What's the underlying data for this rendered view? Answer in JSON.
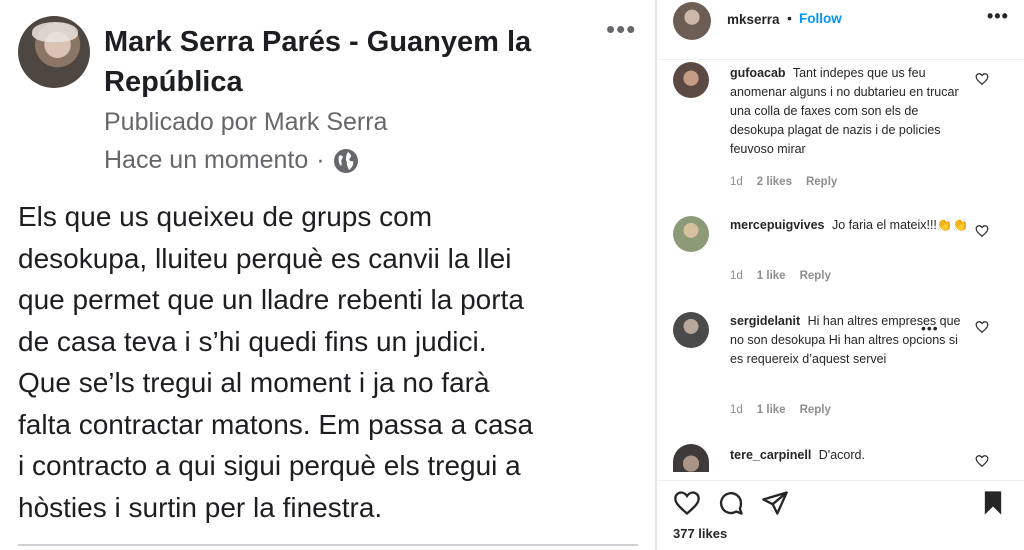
{
  "facebook_post": {
    "title": "Mark Serra Parés - Guanyem la República",
    "more_menu": "•••",
    "published_by": "Publicado por Mark Serra",
    "time": "Hace un momento",
    "time_separator": "·",
    "body_lines": [
      "Els que us queixeu de grups com",
      "desokupa, lluiteu perquè es canvii la llei",
      "que permet que un lladre rebenti la porta",
      "de casa teva i s’hi quedi fins un judici.",
      "Que se’ls tregui al moment i ja no farà",
      "falta contractar matons. Em passa a casa",
      "i contracto a qui sigui perquè els tregui a",
      "hòsties i surtin per la finestra."
    ]
  },
  "instagram": {
    "header": {
      "username": "mkserra",
      "dot": "•",
      "follow_label": "Follow",
      "more_menu": "•••"
    },
    "comments": [
      {
        "username": "gufoacab",
        "text": "Tant indepes que us feu anomenar alguns i no dubtarieu en trucar una colla de faxes com son els de desokupa plagat de nazis i de policies feuvoso mirar",
        "time": "1d",
        "likes": "2 likes",
        "reply": "Reply"
      },
      {
        "username": "mercepuigvives",
        "text": "Jo faria el mateix!!!👏👏",
        "time": "1d",
        "likes": "1 like",
        "reply": "Reply"
      },
      {
        "username": "sergidelanit",
        "text": "Hi han altres empreses que no son desokupa Hi han altres opcions si es requereix d’aquest servei",
        "time": "1d",
        "likes": "1 like",
        "reply": "Reply",
        "more_menu": "•••"
      },
      {
        "username": "tere_carpinell",
        "text": "D'acord.",
        "time": "",
        "likes": "",
        "reply": ""
      }
    ],
    "likes_count": "377 likes",
    "icons": [
      "heart-icon",
      "comment-icon",
      "share-icon",
      "bookmark-icon"
    ],
    "colors": {
      "follow": "#0095f6",
      "meta": "#8e8e8e",
      "text": "#262626"
    }
  }
}
